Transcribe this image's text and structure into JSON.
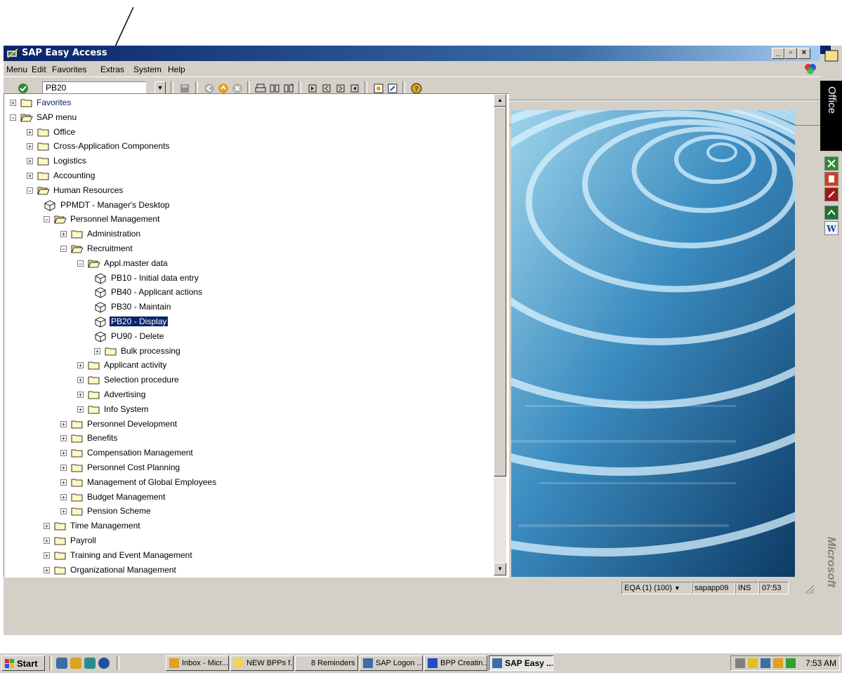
{
  "window": {
    "title": "SAP Easy Access"
  },
  "menu": [
    "Menu",
    "Edit",
    "Favorites",
    "Extras",
    "System",
    "Help"
  ],
  "command_field": {
    "value": "PB20"
  },
  "tree": [
    {
      "label": "Favorites",
      "level": 0,
      "kind": "folder",
      "expanded": false
    },
    {
      "label": "SAP menu",
      "level": 0,
      "kind": "folder",
      "expanded": true
    },
    {
      "label": "Office",
      "level": 1,
      "kind": "folder",
      "expanded": false
    },
    {
      "label": "Cross-Application Components",
      "level": 1,
      "kind": "folder",
      "expanded": false
    },
    {
      "label": "Logistics",
      "level": 1,
      "kind": "folder",
      "expanded": false
    },
    {
      "label": "Accounting",
      "level": 1,
      "kind": "folder",
      "expanded": false
    },
    {
      "label": "Human Resources",
      "level": 1,
      "kind": "folder",
      "expanded": true
    },
    {
      "label": "PPMDT - Manager's Desktop",
      "level": 2,
      "kind": "transaction"
    },
    {
      "label": "Personnel Management",
      "level": 2,
      "kind": "folder",
      "expanded": true
    },
    {
      "label": "Administration",
      "level": 3,
      "kind": "folder",
      "expanded": false
    },
    {
      "label": "Recruitment",
      "level": 3,
      "kind": "folder",
      "expanded": true
    },
    {
      "label": "Appl.master data",
      "level": 4,
      "kind": "folder",
      "expanded": true
    },
    {
      "label": "PB10 - Initial data entry",
      "level": 5,
      "kind": "transaction"
    },
    {
      "label": "PB40 - Applicant actions",
      "level": 5,
      "kind": "transaction"
    },
    {
      "label": "PB30 - Maintain",
      "level": 5,
      "kind": "transaction"
    },
    {
      "label": "PB20 - Display",
      "level": 5,
      "kind": "transaction",
      "selected": true
    },
    {
      "label": "PU90 - Delete",
      "level": 5,
      "kind": "transaction"
    },
    {
      "label": "Bulk processing",
      "level": 5,
      "kind": "folder",
      "expanded": false
    },
    {
      "label": "Applicant activity",
      "level": 4,
      "kind": "folder",
      "expanded": false
    },
    {
      "label": "Selection procedure",
      "level": 4,
      "kind": "folder",
      "expanded": false
    },
    {
      "label": "Advertising",
      "level": 4,
      "kind": "folder",
      "expanded": false
    },
    {
      "label": "Info System",
      "level": 4,
      "kind": "folder",
      "expanded": false
    },
    {
      "label": "Personnel Development",
      "level": 3,
      "kind": "folder",
      "expanded": false
    },
    {
      "label": "Benefits",
      "level": 3,
      "kind": "folder",
      "expanded": false
    },
    {
      "label": "Compensation Management",
      "level": 3,
      "kind": "folder",
      "expanded": false
    },
    {
      "label": "Personnel Cost Planning",
      "level": 3,
      "kind": "folder",
      "expanded": false
    },
    {
      "label": "Management of Global Employees",
      "level": 3,
      "kind": "folder",
      "expanded": false
    },
    {
      "label": "Budget Management",
      "level": 3,
      "kind": "folder",
      "expanded": false
    },
    {
      "label": "Pension Scheme",
      "level": 3,
      "kind": "folder",
      "expanded": false
    },
    {
      "label": "Time Management",
      "level": 2,
      "kind": "folder",
      "expanded": false
    },
    {
      "label": "Payroll",
      "level": 2,
      "kind": "folder",
      "expanded": false
    },
    {
      "label": "Training and Event Management",
      "level": 2,
      "kind": "folder",
      "expanded": false
    },
    {
      "label": "Organizational Management",
      "level": 2,
      "kind": "folder",
      "expanded": false
    }
  ],
  "office_bar": {
    "label": "Office",
    "brand": "Microsoft"
  },
  "status": {
    "system": "EQA (1) (100)",
    "server": "sapapp09",
    "mode": "INS",
    "time": "07:53"
  },
  "taskbar": {
    "start": "Start",
    "tasks": [
      "Inbox - Micr...",
      "NEW BPPs f...",
      "8 Reminders",
      "SAP Logon ...",
      "BPP Creatin...",
      "SAP Easy ..."
    ],
    "clock": "7:53 AM"
  },
  "colors": {
    "titlebar": "#0a246a",
    "selection": "#0a246a",
    "window_bg": "#d4d0c8"
  }
}
